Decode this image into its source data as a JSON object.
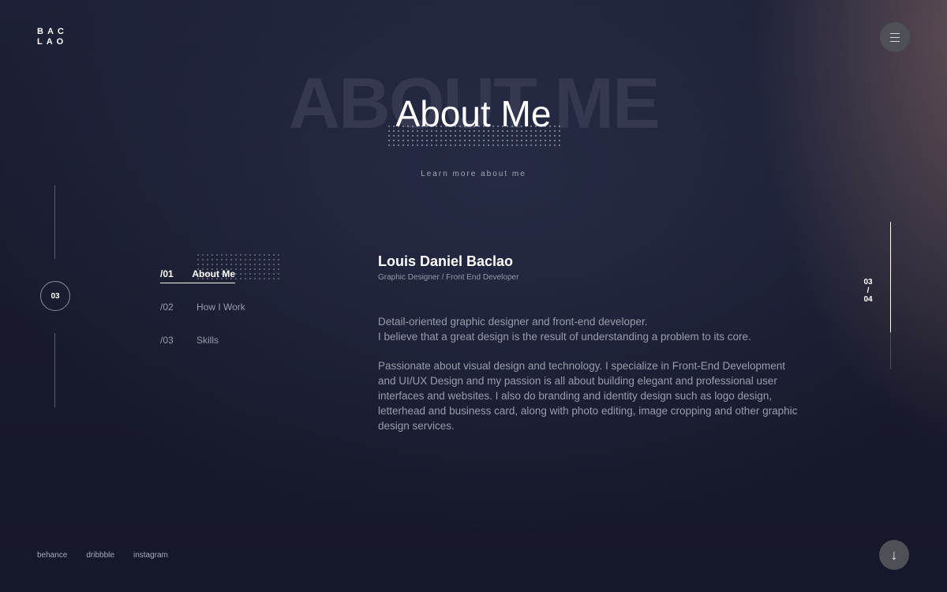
{
  "logo": {
    "line1": "BAC",
    "line2": "LAO"
  },
  "menu": {
    "icon": "hamburger-menu-icon"
  },
  "hero": {
    "background_title": "ABOUT ME",
    "title": "About Me",
    "subtitle": "Learn more about me"
  },
  "section_indicator": {
    "number": "03"
  },
  "nav": {
    "items": [
      {
        "num": "/01",
        "label": "About Me",
        "active": true
      },
      {
        "num": "/02",
        "label": "How I Work",
        "active": false
      },
      {
        "num": "/03",
        "label": "Skills",
        "active": false
      }
    ]
  },
  "profile": {
    "name": "Louis Daniel Baclao",
    "role": "Graphic Designer / Front End Developer",
    "paragraph1_line1": "Detail-oriented graphic designer and front-end developer.",
    "paragraph1_line2": "I believe that a great design is the result of understanding a problem to its core.",
    "paragraph2": "Passionate about visual design and technology. I specialize in Front-End Development and UI/UX Design and my passion is all about building elegant and professional user interfaces and websites. I also do branding and identity design such as logo design, letterhead and business card, along with photo editing, image cropping and other graphic design services."
  },
  "pager": {
    "current": "03",
    "separator": "/",
    "total": "04",
    "progress": 0.75
  },
  "social": {
    "behance": "behance",
    "dribbble": "dribbble",
    "instagram": "instagram"
  },
  "scroll": {
    "icon": "arrow-down-icon",
    "glyph": "↓"
  },
  "colors": {
    "background": "#1b1e33",
    "accent_warm": "#7a6060",
    "text_muted": "#9a9cab",
    "button_bg": "#4f4f58"
  }
}
